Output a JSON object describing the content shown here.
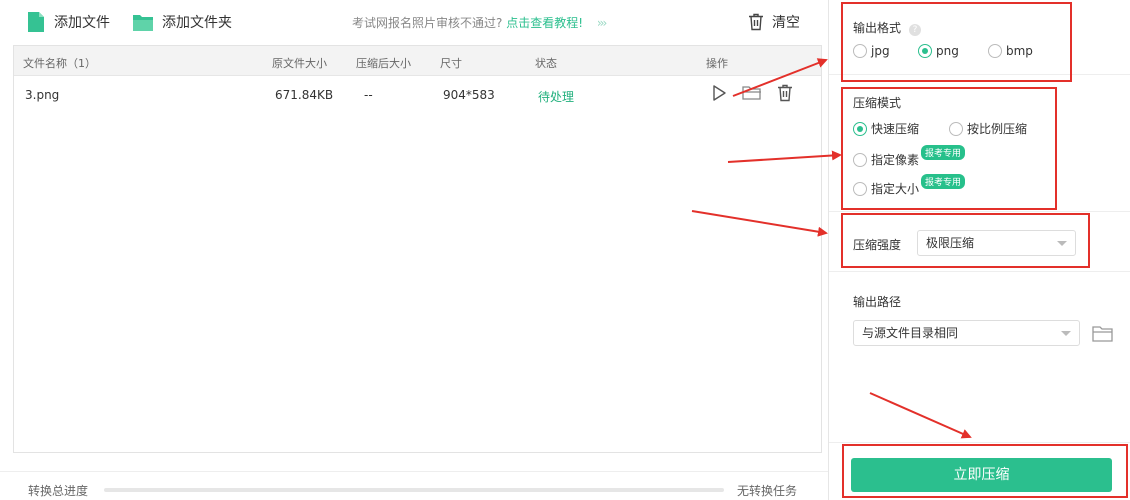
{
  "toolbar": {
    "add_file": "添加文件",
    "add_folder": "添加文件夹",
    "notice": "考试网报名照片审核不通过?",
    "notice_link": "点击查看教程!",
    "notice_chevrons": "›››",
    "clear": "清空"
  },
  "table": {
    "headers": {
      "name": "文件名称（1）",
      "orig_size": "原文件大小",
      "compressed_size": "压缩后大小",
      "dimensions": "尺寸",
      "status": "状态",
      "actions": "操作"
    },
    "rows": [
      {
        "name": "3.png",
        "orig_size": "671.84KB",
        "compressed_size": "--",
        "dimensions": "904*583",
        "status": "待处理"
      }
    ]
  },
  "footer": {
    "progress_label": "转换总进度",
    "progress_value": 0,
    "status": "无转换任务"
  },
  "panel": {
    "output_format": {
      "title": "输出格式",
      "help": "?",
      "options": [
        "jpg",
        "png",
        "bmp"
      ],
      "selected": "png"
    },
    "compress_mode": {
      "title": "压缩模式",
      "options": {
        "fast": "快速压缩",
        "ratio": "按比例压缩",
        "pixels": "指定像素",
        "size": "指定大小"
      },
      "selected": "fast",
      "badge": "报考专用"
    },
    "strength": {
      "title": "压缩强度",
      "value": "极限压缩"
    },
    "output_path": {
      "title": "输出路径",
      "value": "与源文件目录相同"
    },
    "compress_button": "立即压缩"
  },
  "colors": {
    "accent": "#2bbf8e",
    "annotation": "#e3302a"
  }
}
